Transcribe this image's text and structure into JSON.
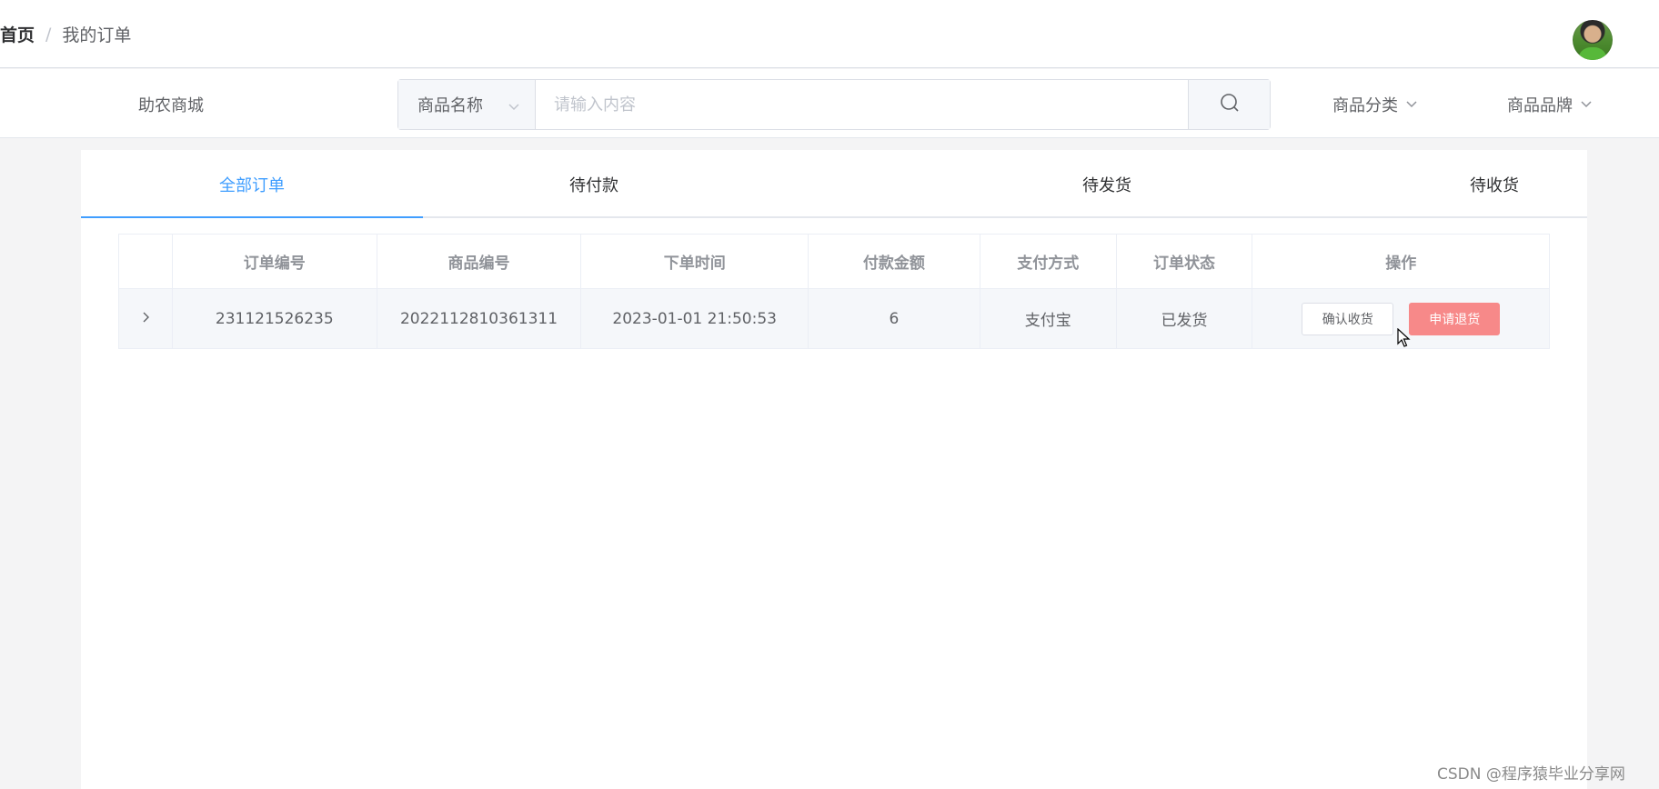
{
  "header": {
    "breadcrumb": {
      "home": "首页",
      "separator": "/",
      "current": "我的订单"
    }
  },
  "nav": {
    "brand": "助农商城",
    "search": {
      "select_value": "商品名称",
      "placeholder": "请输入内容"
    },
    "menus": [
      {
        "label": "商品分类"
      },
      {
        "label": "商品品牌"
      }
    ]
  },
  "tabs": [
    {
      "label": "全部订单",
      "active": true
    },
    {
      "label": "待付款",
      "active": false
    },
    {
      "label": "待发货",
      "active": false
    },
    {
      "label": "待收货",
      "active": false
    }
  ],
  "table": {
    "columns": [
      "订单编号",
      "商品编号",
      "下单时间",
      "付款金额",
      "支付方式",
      "订单状态",
      "操作"
    ],
    "rows": [
      {
        "order_no": "231121526235",
        "product_no": "2022112810361311",
        "time": "2023-01-01 21:50:53",
        "amount": "6",
        "pay_method": "支付宝",
        "status": "已发货",
        "actions": {
          "confirm": "确认收货",
          "refund": "申请退货"
        }
      }
    ]
  },
  "watermark": "CSDN @程序猿毕业分享网",
  "colors": {
    "accent": "#409eff",
    "danger": "#f78989",
    "background": "#f4f4f5"
  },
  "icons": [
    "search-icon",
    "chevron-down-icon",
    "chevron-right-icon",
    "avatar"
  ]
}
